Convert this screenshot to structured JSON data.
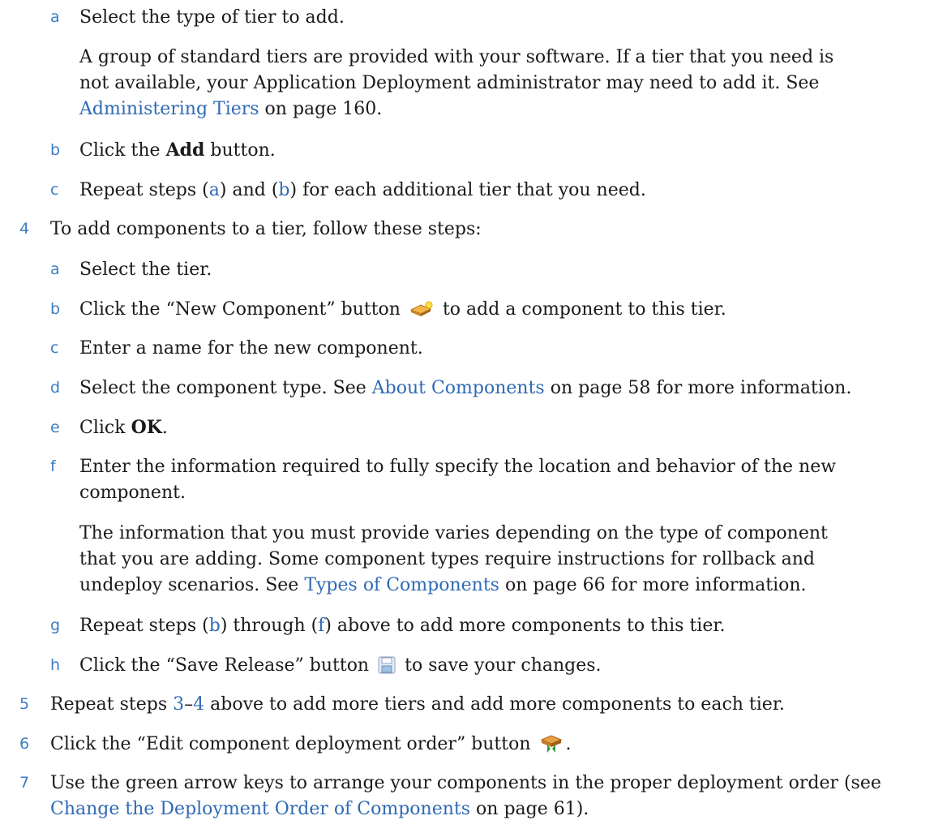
{
  "colors": {
    "marker": "#3b7ec2",
    "link": "#2f6ab5",
    "text": "#1a1a1a"
  },
  "step3": {
    "a": {
      "marker": "a",
      "text": "Select the type of tier to add."
    },
    "a_para": {
      "t1": "A group of standard tiers are provided with your software. If a tier that you need is",
      "t2": "not available, your Application Deployment administrator may need to add it. See",
      "link": "Administering Tiers",
      "t3": " on page 160."
    },
    "b": {
      "marker": "b",
      "t1": "Click the ",
      "bold": "Add",
      "t2": " button."
    },
    "c": {
      "marker": "c",
      "t1": "Repeat steps (",
      "link1": "a",
      "t2": ") and (",
      "link2": "b",
      "t3": ") for each additional tier that you need."
    }
  },
  "step4": {
    "marker": "4",
    "text": "To add components to a tier, follow these steps:",
    "a": {
      "marker": "a",
      "text": "Select the tier."
    },
    "b": {
      "marker": "b",
      "t1": "Click the “New Component” button",
      "t2": "to add a component to this tier.",
      "icon": "new-component-icon"
    },
    "c": {
      "marker": "c",
      "text": "Enter a name for the new component."
    },
    "d": {
      "marker": "d",
      "t1": "Select the component type. See ",
      "link": "About Components",
      "t2": " on page 58 for more information."
    },
    "e": {
      "marker": "e",
      "t1": "Click ",
      "bold": "OK",
      "t2": "."
    },
    "f": {
      "marker": "f",
      "l1": "Enter the information required to fully specify the location and behavior of the new",
      "l2": "component."
    },
    "f_para": {
      "l1": "The information that you must provide varies depending on the type of component",
      "l2": "that you are adding. Some component types require instructions for rollback and",
      "l3a": "undeploy scenarios. See ",
      "link": "Types of Components",
      "l3b": " on page 66 for more information."
    },
    "g": {
      "marker": "g",
      "t1": "Repeat steps (",
      "link1": "b",
      "t2": ") through (",
      "link2": "f",
      "t3": ") above to add more components to this tier."
    },
    "h": {
      "marker": "h",
      "t1": "Click the “Save Release” button",
      "t2": "to save your changes.",
      "icon": "save-icon"
    }
  },
  "step5": {
    "marker": "5",
    "t1": "Repeat steps ",
    "link1": "3",
    "t2": "–",
    "link2": "4",
    "t3": " above to add more tiers and add more components to each tier."
  },
  "step6": {
    "marker": "6",
    "t1": "Click the “Edit component deployment order” button",
    "t2": ".",
    "icon": "deployment-order-icon"
  },
  "step7": {
    "marker": "7",
    "l1": "Use the green arrow keys to arrange your components in the proper deployment order (see",
    "link": "Change the Deployment Order of Components",
    "l2": " on page 61)."
  }
}
